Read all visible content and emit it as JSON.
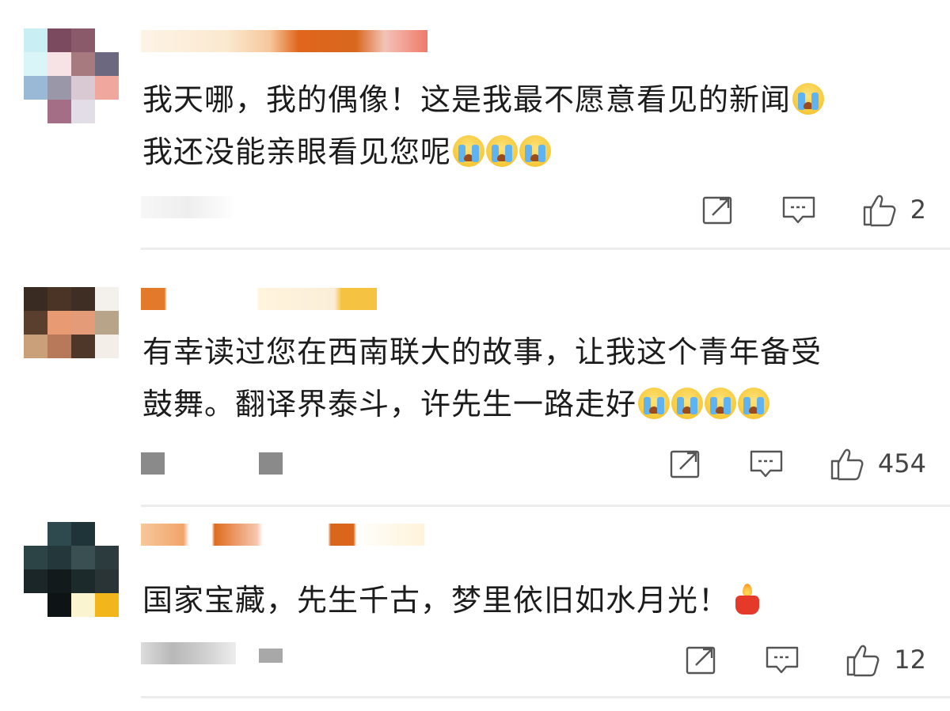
{
  "comments": [
    {
      "text_line1": "我天哪，我的偶像！这是我最不愿意看见的新闻",
      "text_line2": "我还没能亲眼看见您呢",
      "line1_emojis": 1,
      "line2_emojis": 3,
      "likes": "2"
    },
    {
      "text_line1": "有幸读过您在西南联大的故事，让我这个青年备受",
      "text_line2": "鼓舞。翻译界泰斗，许先生一路走好",
      "line2_emojis": 4,
      "likes": "454"
    },
    {
      "text_line1": "国家宝藏，先生千古，梦里依旧如水月光！",
      "trailing_emoji": "candle-icon",
      "likes": "12"
    }
  ],
  "icons": {
    "share": "share-icon",
    "reply": "reply-icon",
    "like": "thumbs-up-icon",
    "cry": "crying-face-icon",
    "candle": "candle-icon"
  },
  "colors": {
    "text": "#1c1c1c",
    "icon": "#555555",
    "divider": "#ececec"
  }
}
